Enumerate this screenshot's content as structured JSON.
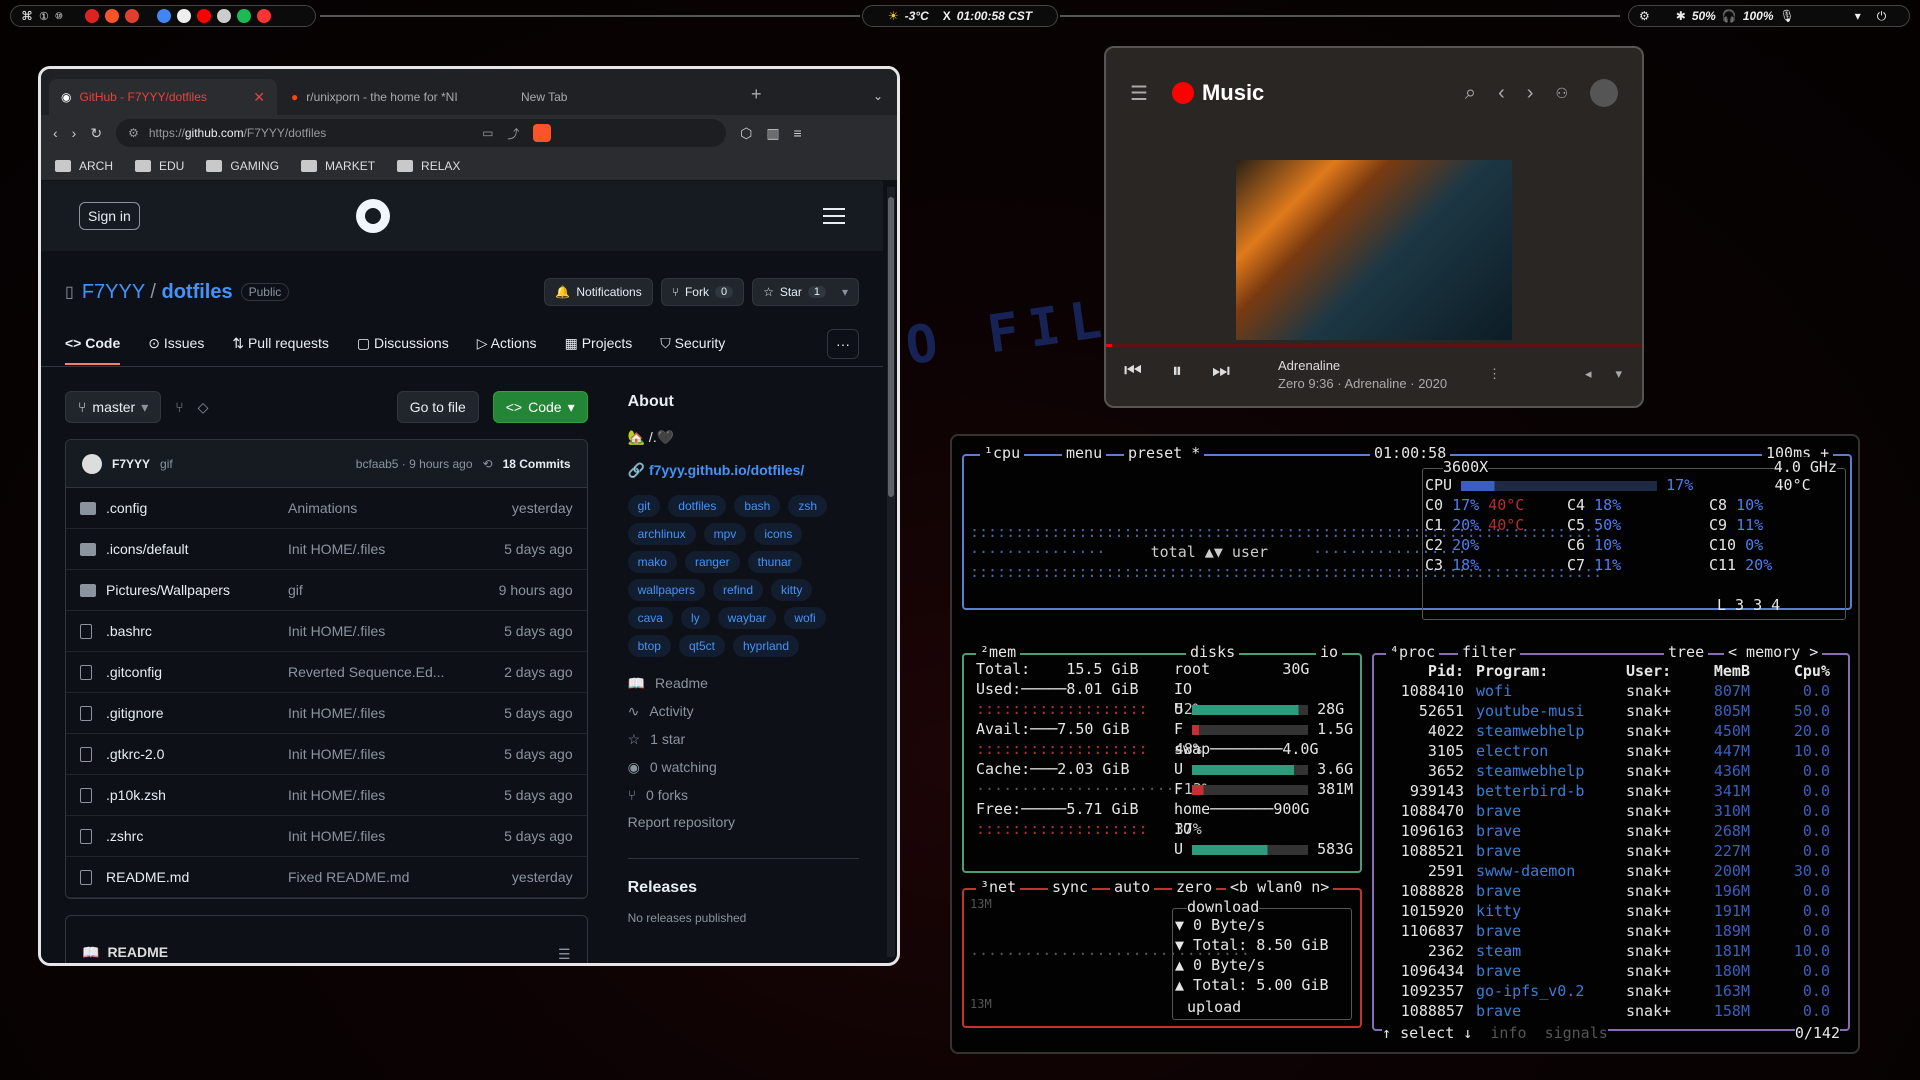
{
  "topbar": {
    "left_icons": [
      "command-icon",
      "workspace-1-icon",
      "workspace-10-icon"
    ],
    "apps": [
      "opera",
      "brave-red",
      "brave",
      "chrome",
      "vscode",
      "youtube",
      "obs",
      "spotify",
      "youtube-music"
    ],
    "weather": "-3°C",
    "time": "01:00:58 CST",
    "battery": "50%",
    "headphones": "100%"
  },
  "browser": {
    "tabs": [
      {
        "label": "GitHub - F7YYY/dotfiles"
      },
      {
        "label": "r/unixporn - the home for *NI"
      },
      {
        "label": "New Tab"
      }
    ],
    "url_prefix": "https://",
    "url_domain": "github.com",
    "url_path": "/F7YYY/dotfiles",
    "bookmarks": [
      "ARCH",
      "EDU",
      "GAMING",
      "MARKET",
      "RELAX"
    ]
  },
  "github": {
    "sign_in": "Sign in",
    "owner": "F7YYY",
    "slash": "/",
    "repo": "dotfiles",
    "visibility": "Public",
    "notifications": "Notifications",
    "fork": "Fork",
    "fork_count": "0",
    "star": "Star",
    "star_count": "1",
    "tabs": [
      "Code",
      "Issues",
      "Pull requests",
      "Discussions",
      "Actions",
      "Projects",
      "Security"
    ],
    "branch": "master",
    "go_to_file": "Go to file",
    "code_btn": "Code",
    "commit": {
      "author": "F7YYY",
      "message": "gif",
      "hash_time": "bcfaab5 · 9 hours ago",
      "commits": "18 Commits"
    },
    "files": [
      {
        "name": ".config",
        "msg": "Animations",
        "date": "yesterday",
        "type": "dir"
      },
      {
        "name": ".icons/default",
        "msg": "Init HOME/.files",
        "date": "5 days ago",
        "type": "dir"
      },
      {
        "name": "Pictures/Wallpapers",
        "msg": "gif",
        "date": "9 hours ago",
        "type": "dir"
      },
      {
        "name": ".bashrc",
        "msg": "Init HOME/.files",
        "date": "5 days ago",
        "type": "file"
      },
      {
        "name": ".gitconfig",
        "msg": "Reverted Sequence.Ed...",
        "date": "2 days ago",
        "type": "file"
      },
      {
        "name": ".gitignore",
        "msg": "Init HOME/.files",
        "date": "5 days ago",
        "type": "file"
      },
      {
        "name": ".gtkrc-2.0",
        "msg": "Init HOME/.files",
        "date": "5 days ago",
        "type": "file"
      },
      {
        "name": ".p10k.zsh",
        "msg": "Init HOME/.files",
        "date": "5 days ago",
        "type": "file"
      },
      {
        "name": ".zshrc",
        "msg": "Init HOME/.files",
        "date": "5 days ago",
        "type": "file"
      },
      {
        "name": "README.md",
        "msg": "Fixed README.md",
        "date": "yesterday",
        "type": "file"
      }
    ],
    "readme_tab": "README",
    "about": {
      "title": "About",
      "description": "🏡 /.🖤",
      "link": "f7yyy.github.io/dotfiles/",
      "topics": [
        "git",
        "dotfiles",
        "bash",
        "zsh",
        "archlinux",
        "mpv",
        "icons",
        "mako",
        "ranger",
        "thunar",
        "wallpapers",
        "refind",
        "kitty",
        "cava",
        "ly",
        "waybar",
        "wofi",
        "btop",
        "qt5ct",
        "hyprland"
      ],
      "readme": "Readme",
      "activity": "Activity",
      "stars": "1 star",
      "watching": "0 watching",
      "forks": "0 forks",
      "report": "Report repository"
    },
    "releases_title": "Releases",
    "releases_note": "No releases published"
  },
  "music": {
    "app": "Music",
    "track": "Adrenaline",
    "details": "Zero 9:36 · Adrenaline · 2020"
  },
  "btop": {
    "cpu_title": "¹cpu",
    "menu": "menu",
    "preset": "preset *",
    "clock": "01:00:58",
    "interval": "100ms +",
    "model": "3600X",
    "freq": "4.0 GHz",
    "cpu_total": "17%",
    "cpu_temp": "40°C",
    "graph_label": "total ▲▼ user",
    "cores": [
      {
        "n": "C0",
        "v": "17%",
        "t": "40°C"
      },
      {
        "n": "C1",
        "v": "20%",
        "t": "40°C"
      },
      {
        "n": "C2",
        "v": "20%",
        "t": ""
      },
      {
        "n": "C3",
        "v": "18%",
        "t": ""
      },
      {
        "n": "C4",
        "v": "18%"
      },
      {
        "n": "C5",
        "v": "50%"
      },
      {
        "n": "C6",
        "v": "10%"
      },
      {
        "n": "C7",
        "v": "11%"
      },
      {
        "n": "C8",
        "v": "10%"
      },
      {
        "n": "C9",
        "v": "11%"
      },
      {
        "n": "C10",
        "v": "0%"
      },
      {
        "n": "C11",
        "v": "20%"
      }
    ],
    "load": "L 3 3 4",
    "mem": {
      "title": "²mem",
      "total": "15.5 GiB",
      "used": "8.01 GiB",
      "used_pct": "52%",
      "avail": "7.50 GiB",
      "avail_pct": "48%",
      "cache": "2.03 GiB",
      "cache_pct": "13%",
      "free": "5.71 GiB",
      "free_pct": "37%"
    },
    "disks": {
      "title": "disks",
      "io": "io",
      "root": "30G",
      "root_u": "28G",
      "root_f": "1.5G",
      "swap": "4.0G",
      "swap_u": "3.6G",
      "swap_f": "381M",
      "home": "900G",
      "home_u": "583G"
    },
    "net": {
      "title": "³net",
      "sync": "sync",
      "auto": "auto",
      "zero": "zero",
      "iface": "<b wlan0 n>",
      "scale_top": "13M",
      "scale_bottom": "13M",
      "download": "download",
      "dl_rate": "▼ 0 Byte/s",
      "dl_total": "▼ Total: 8.50 GiB",
      "ul_rate": "▲ 0 Byte/s",
      "ul_total": "▲ Total: 5.00 GiB",
      "upload": "upload"
    },
    "proc": {
      "title": "⁴proc",
      "filter": "filter",
      "tree": "tree",
      "sort": "< memory >",
      "headers": {
        "pid": "Pid:",
        "program": "Program:",
        "user": "User:",
        "mem": "MemB",
        "cpu": "Cpu%"
      },
      "rows": [
        {
          "pid": "1088410",
          "prog": "wofi",
          "user": "snak+",
          "mem": "807M",
          "cpu": "0.0"
        },
        {
          "pid": "52651",
          "prog": "youtube-musi",
          "user": "snak+",
          "mem": "805M",
          "cpu": "50.0"
        },
        {
          "pid": "4022",
          "prog": "steamwebhelp",
          "user": "snak+",
          "mem": "450M",
          "cpu": "20.0"
        },
        {
          "pid": "3105",
          "prog": "electron",
          "user": "snak+",
          "mem": "447M",
          "cpu": "10.0"
        },
        {
          "pid": "3652",
          "prog": "steamwebhelp",
          "user": "snak+",
          "mem": "436M",
          "cpu": "0.0"
        },
        {
          "pid": "939143",
          "prog": "betterbird-b",
          "user": "snak+",
          "mem": "341M",
          "cpu": "0.0"
        },
        {
          "pid": "1088470",
          "prog": "brave",
          "user": "snak+",
          "mem": "310M",
          "cpu": "0.0"
        },
        {
          "pid": "1096163",
          "prog": "brave",
          "user": "snak+",
          "mem": "268M",
          "cpu": "0.0"
        },
        {
          "pid": "1088521",
          "prog": "brave",
          "user": "snak+",
          "mem": "227M",
          "cpu": "0.0"
        },
        {
          "pid": "2591",
          "prog": "swww-daemon",
          "user": "snak+",
          "mem": "200M",
          "cpu": "30.0"
        },
        {
          "pid": "1088828",
          "prog": "brave",
          "user": "snak+",
          "mem": "196M",
          "cpu": "0.0"
        },
        {
          "pid": "1015920",
          "prog": "kitty",
          "user": "snak+",
          "mem": "191M",
          "cpu": "0.0"
        },
        {
          "pid": "1106837",
          "prog": "brave",
          "user": "snak+",
          "mem": "189M",
          "cpu": "0.0"
        },
        {
          "pid": "2362",
          "prog": "steam",
          "user": "snak+",
          "mem": "181M",
          "cpu": "10.0"
        },
        {
          "pid": "1096434",
          "prog": "brave",
          "user": "snak+",
          "mem": "180M",
          "cpu": "0.0"
        },
        {
          "pid": "1092357",
          "prog": "go-ipfs_v0.2",
          "user": "snak+",
          "mem": "163M",
          "cpu": "0.0"
        },
        {
          "pid": "1088857",
          "prog": "brave",
          "user": "snak+",
          "mem": "158M",
          "cpu": "0.0"
        }
      ],
      "select": "select",
      "info": "info",
      "signals": "signals",
      "count": "0/142"
    }
  },
  "background_text": "O FILE"
}
